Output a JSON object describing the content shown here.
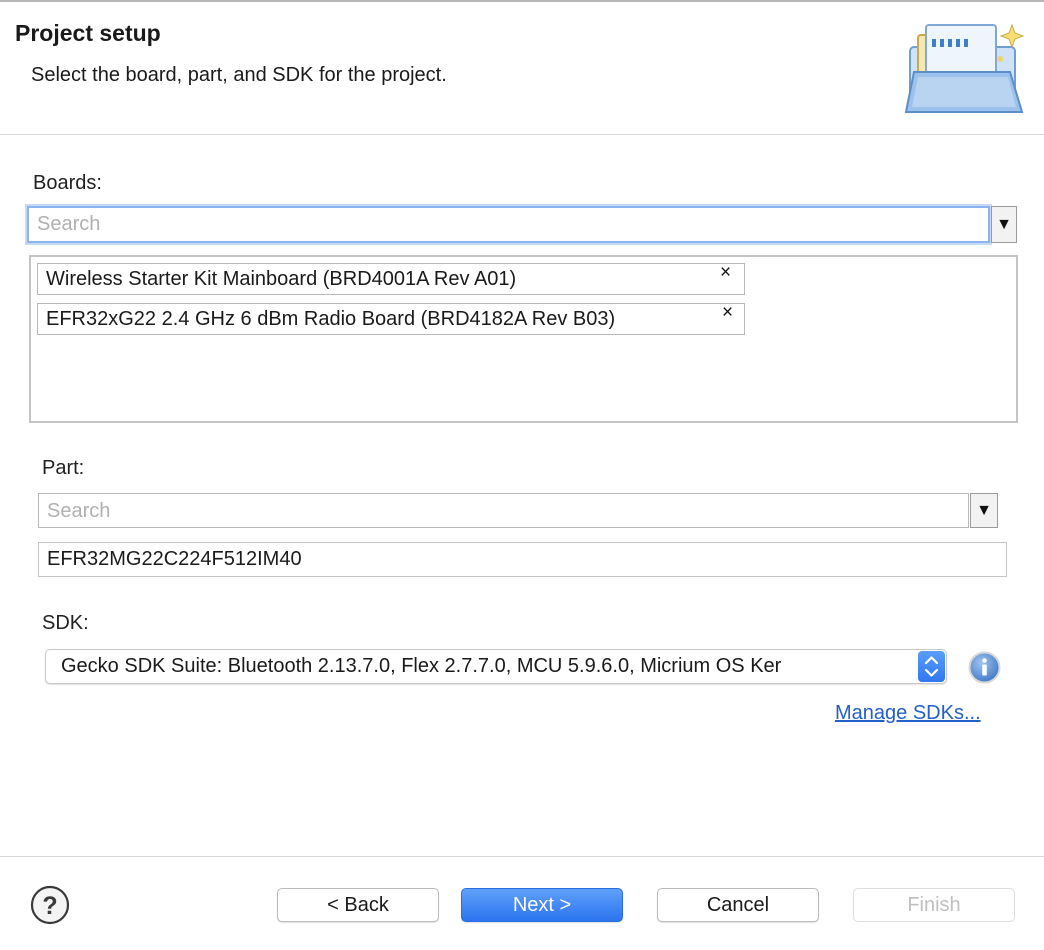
{
  "header": {
    "title": "Project setup",
    "description": "Select the board, part, and SDK for the project."
  },
  "boards": {
    "label": "Boards:",
    "search_placeholder": "Search",
    "selected": [
      "Wireless Starter Kit Mainboard (BRD4001A Rev A01)",
      "EFR32xG22 2.4 GHz 6 dBm Radio Board (BRD4182A Rev B03)"
    ],
    "remove_glyph": "×",
    "dropdown_glyph": "▼"
  },
  "part": {
    "label": "Part:",
    "search_placeholder": "Search",
    "value": "EFR32MG22C224F512IM40",
    "dropdown_glyph": "▼"
  },
  "sdk": {
    "label": "SDK:",
    "selected": "Gecko SDK Suite: Bluetooth 2.13.7.0, Flex 2.7.7.0, MCU 5.9.6.0, Micrium OS Ker",
    "manage_link": "Manage SDKs..."
  },
  "footer": {
    "back": "< Back",
    "next": "Next >",
    "cancel": "Cancel",
    "finish": "Finish"
  },
  "icons": {
    "wizard_graphic": "folder-wizard-icon",
    "info": "info-icon",
    "help": "help-icon"
  },
  "colors": {
    "accent": "#2f78f0",
    "link": "#2360c8",
    "focus_ring": "#8bb4f0"
  }
}
